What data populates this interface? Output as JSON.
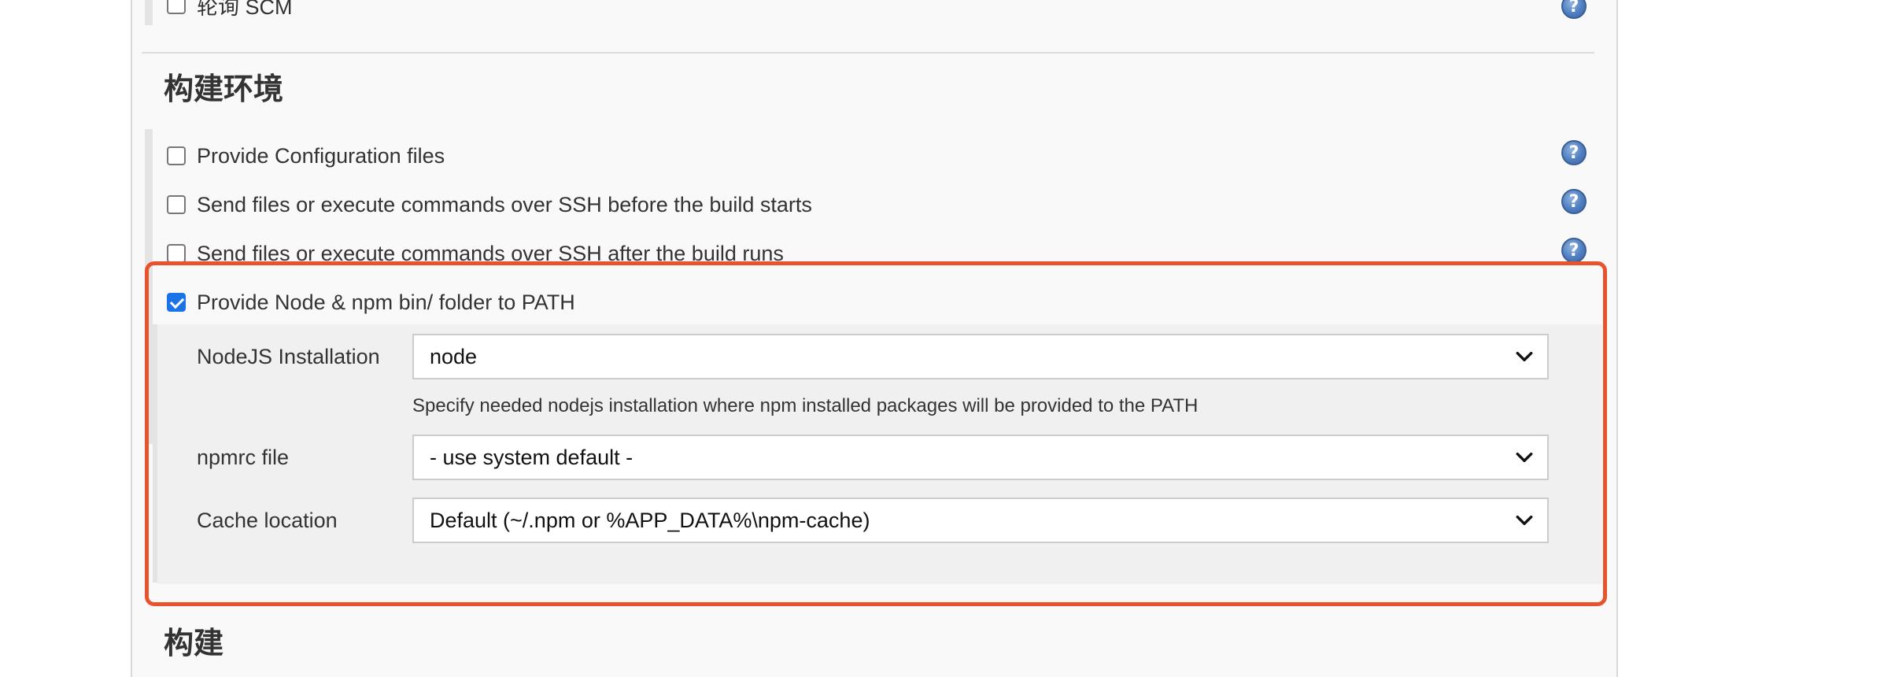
{
  "previous_section": {
    "checkbox_label": "轮询 SCM",
    "checked": false
  },
  "build_env": {
    "title": "构建环境",
    "options": [
      {
        "label": "Provide Configuration files",
        "checked": false
      },
      {
        "label": "Send files or execute commands over SSH before the build starts",
        "checked": false
      },
      {
        "label": "Send files or execute commands over SSH after the build runs",
        "checked": false
      },
      {
        "label": "Provide Node & npm bin/ folder to PATH",
        "checked": true
      }
    ],
    "node_config": {
      "nodejs_installation": {
        "label": "NodeJS Installation",
        "value": "node",
        "hint": "Specify needed nodejs installation where npm installed packages will be provided to the PATH"
      },
      "npmrc_file": {
        "label": "npmrc file",
        "value": "- use system default -"
      },
      "cache_location": {
        "label": "Cache location",
        "value": "Default (~/.npm or %APP_DATA%\\npm-cache)"
      }
    }
  },
  "build": {
    "title": "构建"
  },
  "icons": {
    "help": "help-icon",
    "dropdown": "chevron-down-icon"
  },
  "colors": {
    "highlight_border": "#e8532b",
    "checkbox_checked": "#1a73e8",
    "help_icon": "#4f7fc0"
  }
}
